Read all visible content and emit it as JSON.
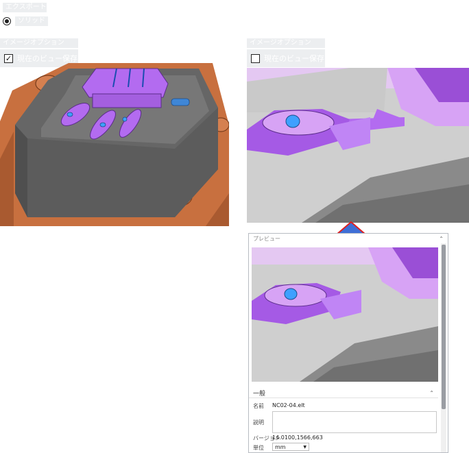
{
  "export_type": {
    "label": "エクスポートタイプ",
    "option_label": "ソリッド"
  },
  "image_options_left": {
    "label": "イメージオプション",
    "save_view_label": "現在のビュー保存",
    "checked": true
  },
  "image_options_right": {
    "label": "イメージオプション",
    "save_view_label": "現在のビュー保存",
    "checked": false
  },
  "check_mark": "✓",
  "preview_dialog": {
    "header": "プレビュー",
    "general_section": "一般",
    "name_label": "名前",
    "name_value": "NC02-04.elt",
    "description_label": "説明",
    "description_value": "",
    "version_label": "バージョン",
    "version_value": "14.0100,1566,663",
    "unit_label": "単位",
    "unit_value": "mm"
  },
  "icons": {
    "collapse": "chevron-up-icon",
    "dropdown": "caret-down-icon",
    "arrow": "up-arrow-icon"
  },
  "colors": {
    "part_purple": "#b36bf0",
    "mold_gray": "#6a6a6a",
    "base_copper": "#c8703f",
    "arrow_blue": "#3f6fd6",
    "arrow_red": "#e02020"
  }
}
